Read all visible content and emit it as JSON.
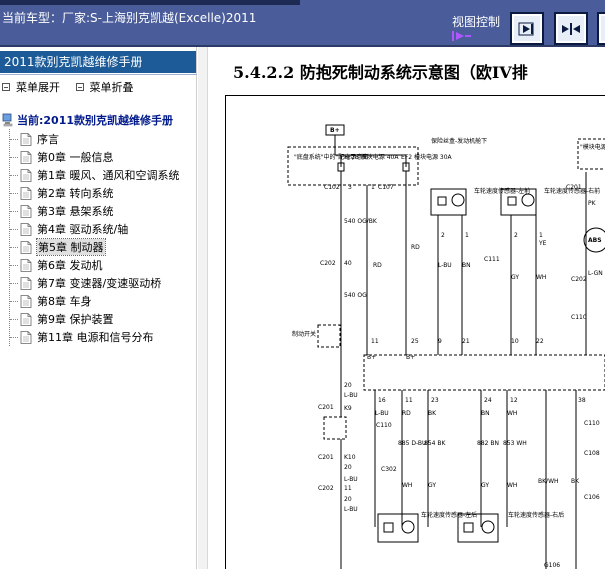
{
  "header": {
    "title": "当前车型：厂家:S-上海别克凯越(Excelle)2011",
    "view_control_label": "视图控制",
    "buttons": [
      {
        "name": "next-page-button",
        "icon": "arrow-right-bar-icon"
      },
      {
        "name": "fit-width-button",
        "icon": "double-arrow-icon"
      },
      {
        "name": "more-button",
        "icon": "partial-icon"
      }
    ]
  },
  "sidebar": {
    "title": "2011款别克凯越维修手册",
    "expand_label": "菜单展开",
    "collapse_label": "菜单折叠",
    "root_label": "当前:2011款别克凯越维修手册",
    "items": [
      {
        "label": "序言"
      },
      {
        "label": "第0章 一般信息"
      },
      {
        "label": "第1章 暖风、通风和空调系统"
      },
      {
        "label": "第2章 转向系统"
      },
      {
        "label": "第3章 悬架系统"
      },
      {
        "label": "第4章 驱动系统/轴"
      },
      {
        "label": "第5章 制动器",
        "selected": true
      },
      {
        "label": "第6章 发动机"
      },
      {
        "label": "第7章 变速器/变速驱动桥"
      },
      {
        "label": "第8章 车身"
      },
      {
        "label": "第9章 保护装置"
      },
      {
        "label": "第11章 电源和信号分布"
      }
    ]
  },
  "content": {
    "title": "5.4.2.2 防抱死制动系统示意图（欧IV排",
    "diagram": {
      "fuse_box_label": "B+",
      "fuse_note": "\"底盘系统\"中的\"配电示意图\"",
      "fuse_right_note": "保险丝盒-发动机舱下",
      "fuse_left": "EF26 模块电源 40A",
      "fuse_right": "EF2 模块电源 30A",
      "connectors": [
        "C102",
        "C107",
        "C202",
        "C201",
        "C101",
        "C203",
        "C110",
        "C111",
        "C108",
        "C106",
        "G106"
      ],
      "pin_labels": [
        "3",
        "1",
        "40",
        "20",
        "K9",
        "K10",
        "11",
        "2",
        "1",
        "9",
        "21",
        "10",
        "22",
        "25",
        "16",
        "11",
        "23",
        "24",
        "12",
        "38",
        "4",
        "5",
        "8",
        "7",
        "1",
        "2"
      ],
      "wire_labels": [
        "540 OG/BK",
        "540 OG",
        "RD",
        "L-BU",
        "BN",
        "GY",
        "WH",
        "BK",
        "885 D-BU",
        "854 BK",
        "882 BN",
        "853 WH",
        "BK/WH",
        "L-GN",
        "PK",
        "YE"
      ],
      "sensor_left_top": "车轮速度传感器-左前",
      "sensor_right_top": "车轮速度传感器-右前",
      "sensor_left_bottom": "车轮速度传感器-左后",
      "sensor_right_bottom": "车轮速度传感器-右后",
      "ignition_label": "制动开关",
      "module_label": "ABS",
      "ground": "G106",
      "side_right_note": "\"模块电源\"中的\"配电示意图\""
    }
  },
  "colors": {
    "header_bg": "#4a5d9a",
    "sidebar_title_bg": "#1d5b98",
    "tree_root_text": "#001a8c",
    "view_ctrl_icon": "#b056ff"
  }
}
